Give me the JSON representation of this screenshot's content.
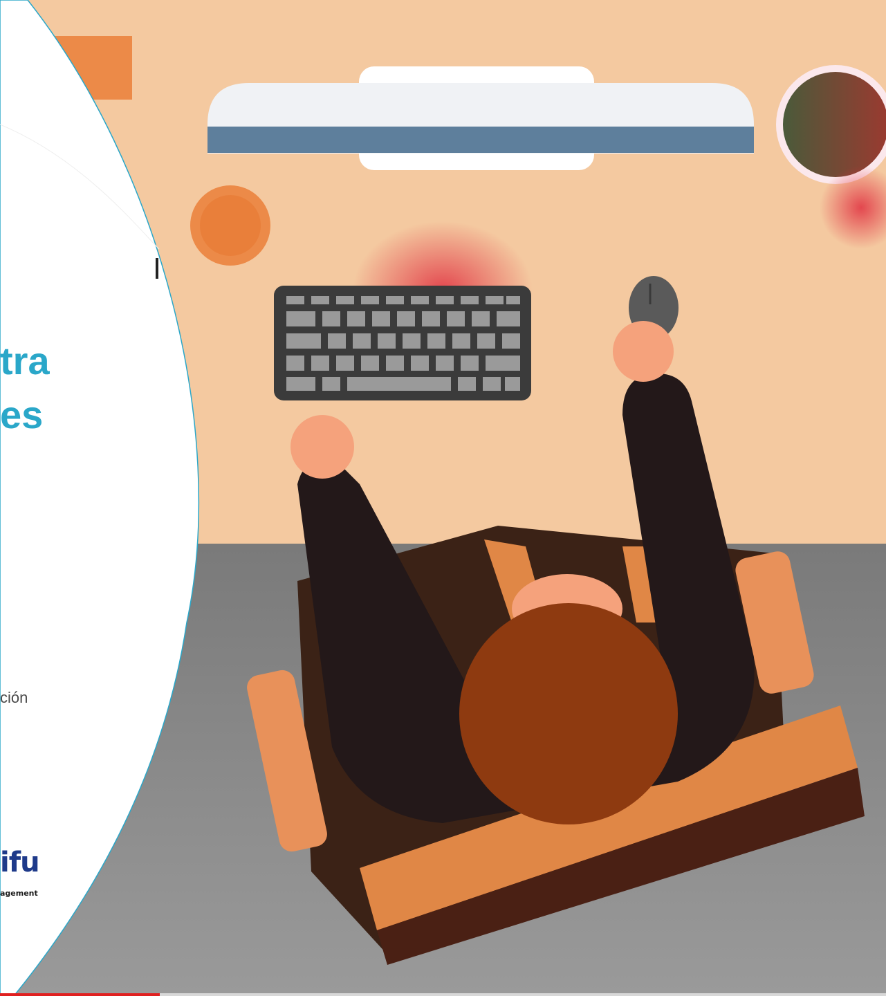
{
  "slide": {
    "title_line_1": "tra",
    "title_line_2": "es",
    "subtitle": "ción",
    "logo_name": "ifu",
    "logo_tagline": "agement"
  },
  "video_progress": 0.18,
  "colors": {
    "accent": "#2aa7c9",
    "logo_blue": "#1e3a8a",
    "desk": "#f4c9a0",
    "floor": "#7f7f7f",
    "sweater": "#231819",
    "hair": "#8e3a10",
    "skin": "#f5a27c",
    "chair": "#e08746",
    "progress": "#e02020"
  }
}
